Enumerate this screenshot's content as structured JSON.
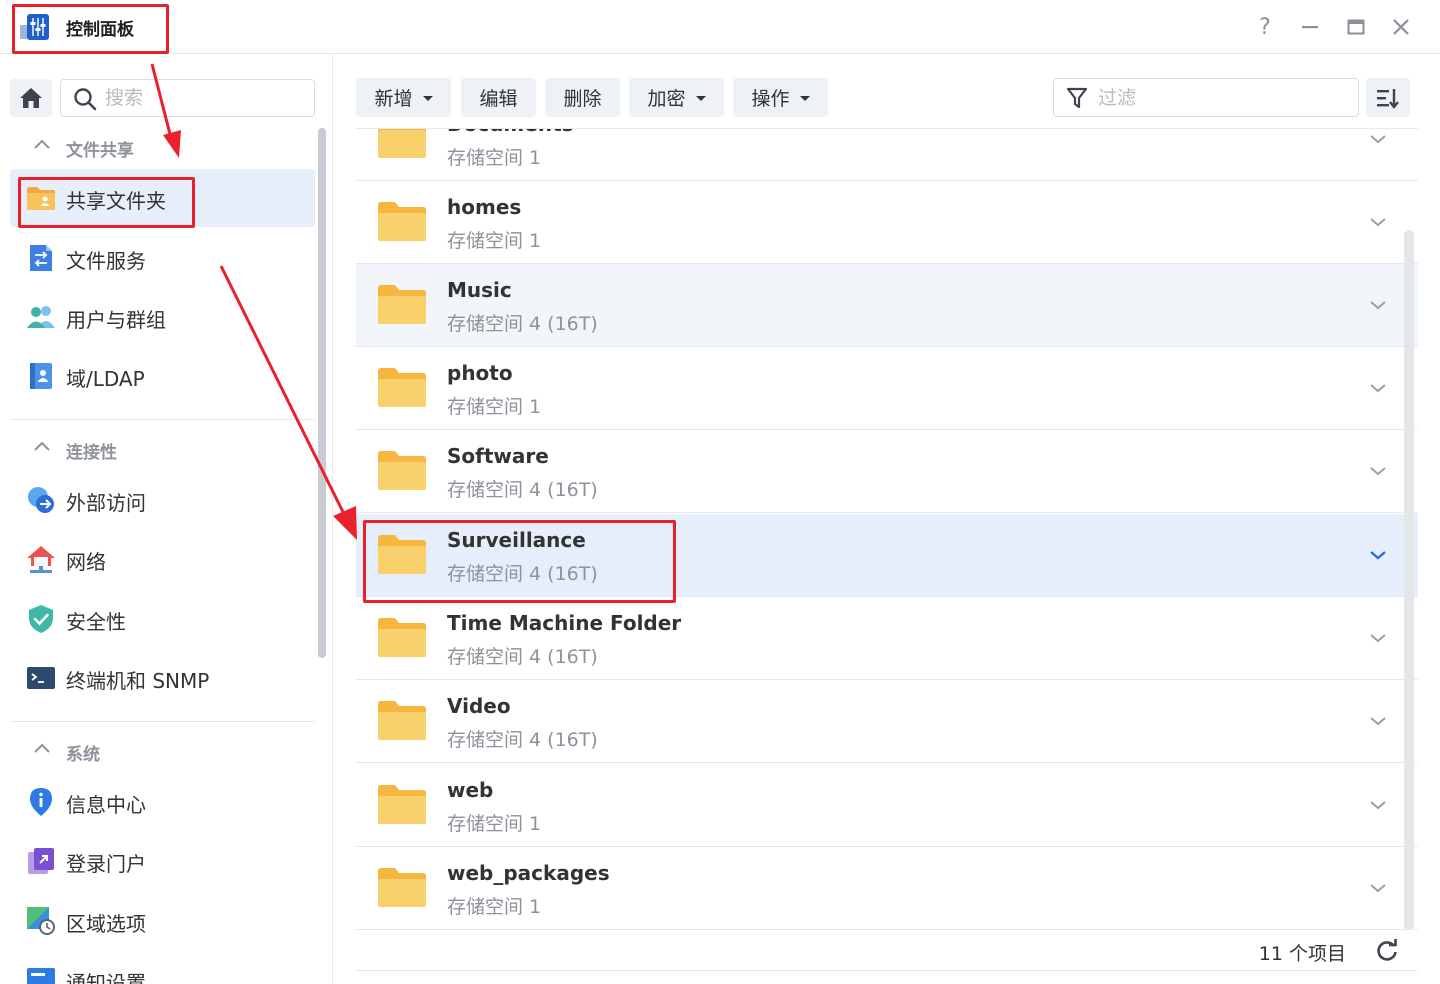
{
  "window": {
    "title": "控制面板",
    "help_label": "?"
  },
  "sidebar": {
    "search_placeholder": "搜索",
    "sections": [
      {
        "label": "文件共享"
      },
      {
        "label": "连接性"
      },
      {
        "label": "系统"
      }
    ],
    "items": [
      {
        "label": "共享文件夹",
        "icon": "shared-folder-icon"
      },
      {
        "label": "文件服务",
        "icon": "file-services-icon"
      },
      {
        "label": "用户与群组",
        "icon": "users-groups-icon"
      },
      {
        "label": "域/LDAP",
        "icon": "domain-ldap-icon"
      },
      {
        "label": "外部访问",
        "icon": "external-access-icon"
      },
      {
        "label": "网络",
        "icon": "network-icon"
      },
      {
        "label": "安全性",
        "icon": "security-shield-icon"
      },
      {
        "label": "终端机和 SNMP",
        "icon": "terminal-icon"
      },
      {
        "label": "信息中心",
        "icon": "info-center-icon"
      },
      {
        "label": "登录门户",
        "icon": "login-portal-icon"
      },
      {
        "label": "区域选项",
        "icon": "regional-options-icon"
      },
      {
        "label": "通知设置",
        "icon": "notification-icon"
      }
    ]
  },
  "toolbar": {
    "create_label": "新增",
    "edit_label": "编辑",
    "delete_label": "删除",
    "encrypt_label": "加密",
    "action_label": "操作",
    "filter_placeholder": "过滤"
  },
  "folders": [
    {
      "name": "Documents",
      "volume": "存储空间 1"
    },
    {
      "name": "homes",
      "volume": "存储空间 1"
    },
    {
      "name": "Music",
      "volume": "存储空间 4 (16T)"
    },
    {
      "name": "photo",
      "volume": "存储空间 1"
    },
    {
      "name": "Software",
      "volume": "存储空间 4 (16T)"
    },
    {
      "name": "Surveillance",
      "volume": "存储空间 4 (16T)"
    },
    {
      "name": "Time Machine Folder",
      "volume": "存储空间 4 (16T)"
    },
    {
      "name": "Video",
      "volume": "存储空间 4 (16T)"
    },
    {
      "name": "web",
      "volume": "存储空间 1"
    },
    {
      "name": "web_packages",
      "volume": "存储空间 1"
    }
  ],
  "footer": {
    "item_count": "11 个项目"
  },
  "colors": {
    "accent": "#1f6fd6",
    "folder": "#f7cf6a",
    "annotation": "#e8212b",
    "selected_row": "#e6eefb"
  }
}
